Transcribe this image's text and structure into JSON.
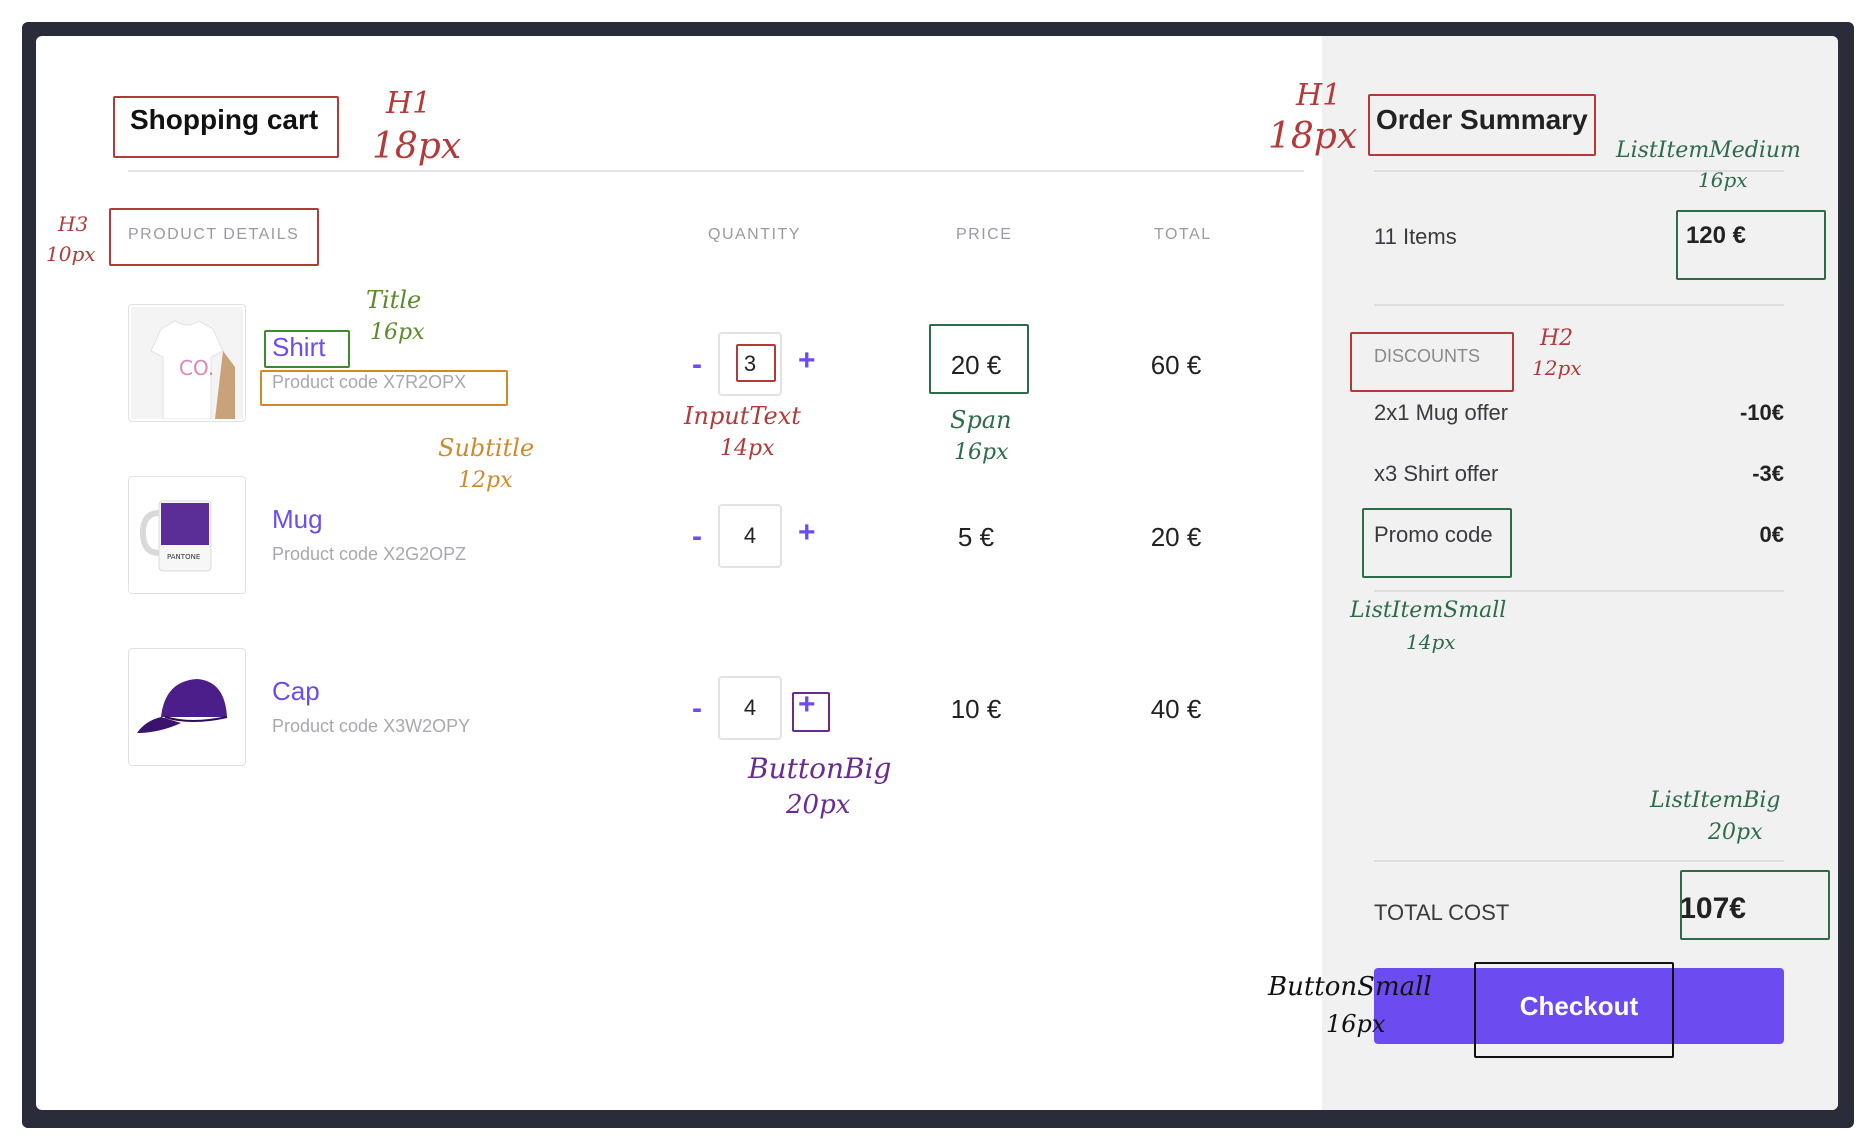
{
  "cart": {
    "title": "Shopping cart",
    "columns": {
      "product": "PRODUCT DETAILS",
      "quantity": "QUANTITY",
      "price": "PRICE",
      "total": "TOTAL"
    },
    "items": [
      {
        "name": "Shirt",
        "code": "Product code X7R2OPX",
        "qty": "3",
        "price": "20 €",
        "total": "60 €",
        "icon": "shirt-image"
      },
      {
        "name": "Mug",
        "code": "Product code X2G2OPZ",
        "qty": "4",
        "price": "5 €",
        "total": "20 €",
        "icon": "mug-image"
      },
      {
        "name": "Cap",
        "code": "Product code X3W2OPY",
        "qty": "4",
        "price": "10 €",
        "total": "40 €",
        "icon": "cap-image"
      }
    ],
    "minus_label": "-",
    "plus_label": "+"
  },
  "summary": {
    "title": "Order Summary",
    "items_label": "11 Items",
    "items_value": "120 €",
    "discounts_label": "DISCOUNTS",
    "discounts": [
      {
        "label": "2x1 Mug offer",
        "value": "-10€"
      },
      {
        "label": "x3 Shirt offer",
        "value": "-3€"
      },
      {
        "label": "Promo code",
        "value": "0€"
      }
    ],
    "total_label": "TOTAL COST",
    "total_value": "107€",
    "checkout_label": "Checkout"
  },
  "annotations": {
    "h1_left": "H1",
    "h1_left_size": "18px",
    "h1_right": "H1",
    "h1_right_size": "18px",
    "h3": "H3",
    "h3_size": "10px",
    "title": "Title",
    "title_size": "16px",
    "subtitle": "Subtitle",
    "subtitle_size": "12px",
    "inputtext": "InputText",
    "inputtext_size": "14px",
    "span": "Span",
    "span_size": "16px",
    "buttonbig": "ButtonBig",
    "buttonbig_size": "20px",
    "listitemmedium": "ListItemMedium",
    "listitemmedium_size": "16px",
    "h2": "H2",
    "h2_size": "12px",
    "listitemsmall": "ListItemSmall",
    "listitemsmall_size": "14px",
    "listitembig": "ListItemBig",
    "listitembig_size": "20px",
    "buttonsmall": "ButtonSmall",
    "buttonsmall_size": "16px"
  },
  "colors": {
    "accent": "#6c4cf0",
    "annotation_red": "#b23a3a",
    "annotation_green": "#2e6b4a",
    "annotation_orange": "#d08a2b",
    "annotation_purple": "#6a2a92"
  }
}
